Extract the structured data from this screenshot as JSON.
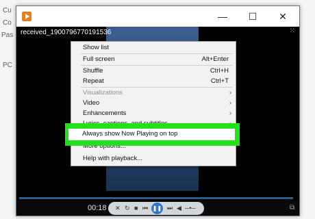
{
  "background": {
    "items": [
      "Cu",
      "Co",
      "Pas",
      "PC"
    ]
  },
  "window": {
    "file_title": "received_1900796770191536",
    "minimize_glyph": "—",
    "maximize_glyph": "☐",
    "close_glyph": "✕"
  },
  "controls": {
    "time": "00:18"
  },
  "menu": {
    "items": [
      {
        "label": "Show list",
        "shortcut": "",
        "submenu": false,
        "disabled": false
      },
      {
        "label": "Full screen",
        "shortcut": "Alt+Enter",
        "submenu": false,
        "disabled": false
      },
      {
        "label": "Shuffle",
        "shortcut": "Ctrl+H",
        "submenu": false,
        "disabled": false
      },
      {
        "label": "Repeat",
        "shortcut": "Ctrl+T",
        "submenu": false,
        "disabled": false
      },
      {
        "label": "Visualizations",
        "shortcut": "",
        "submenu": true,
        "disabled": true
      },
      {
        "label": "Video",
        "shortcut": "",
        "submenu": true,
        "disabled": false
      },
      {
        "label": "Enhancements",
        "shortcut": "",
        "submenu": true,
        "disabled": false
      },
      {
        "label": "Lyrics, captions, and subtitles",
        "shortcut": "",
        "submenu": true,
        "disabled": false
      },
      {
        "label": "Always show Now Playing on top",
        "shortcut": "",
        "submenu": false,
        "disabled": false
      },
      {
        "label": "More options...",
        "shortcut": "",
        "submenu": false,
        "disabled": false
      },
      {
        "label": "Help with playback...",
        "shortcut": "",
        "submenu": false,
        "disabled": false
      }
    ],
    "highlight_color": "#22e01a"
  }
}
